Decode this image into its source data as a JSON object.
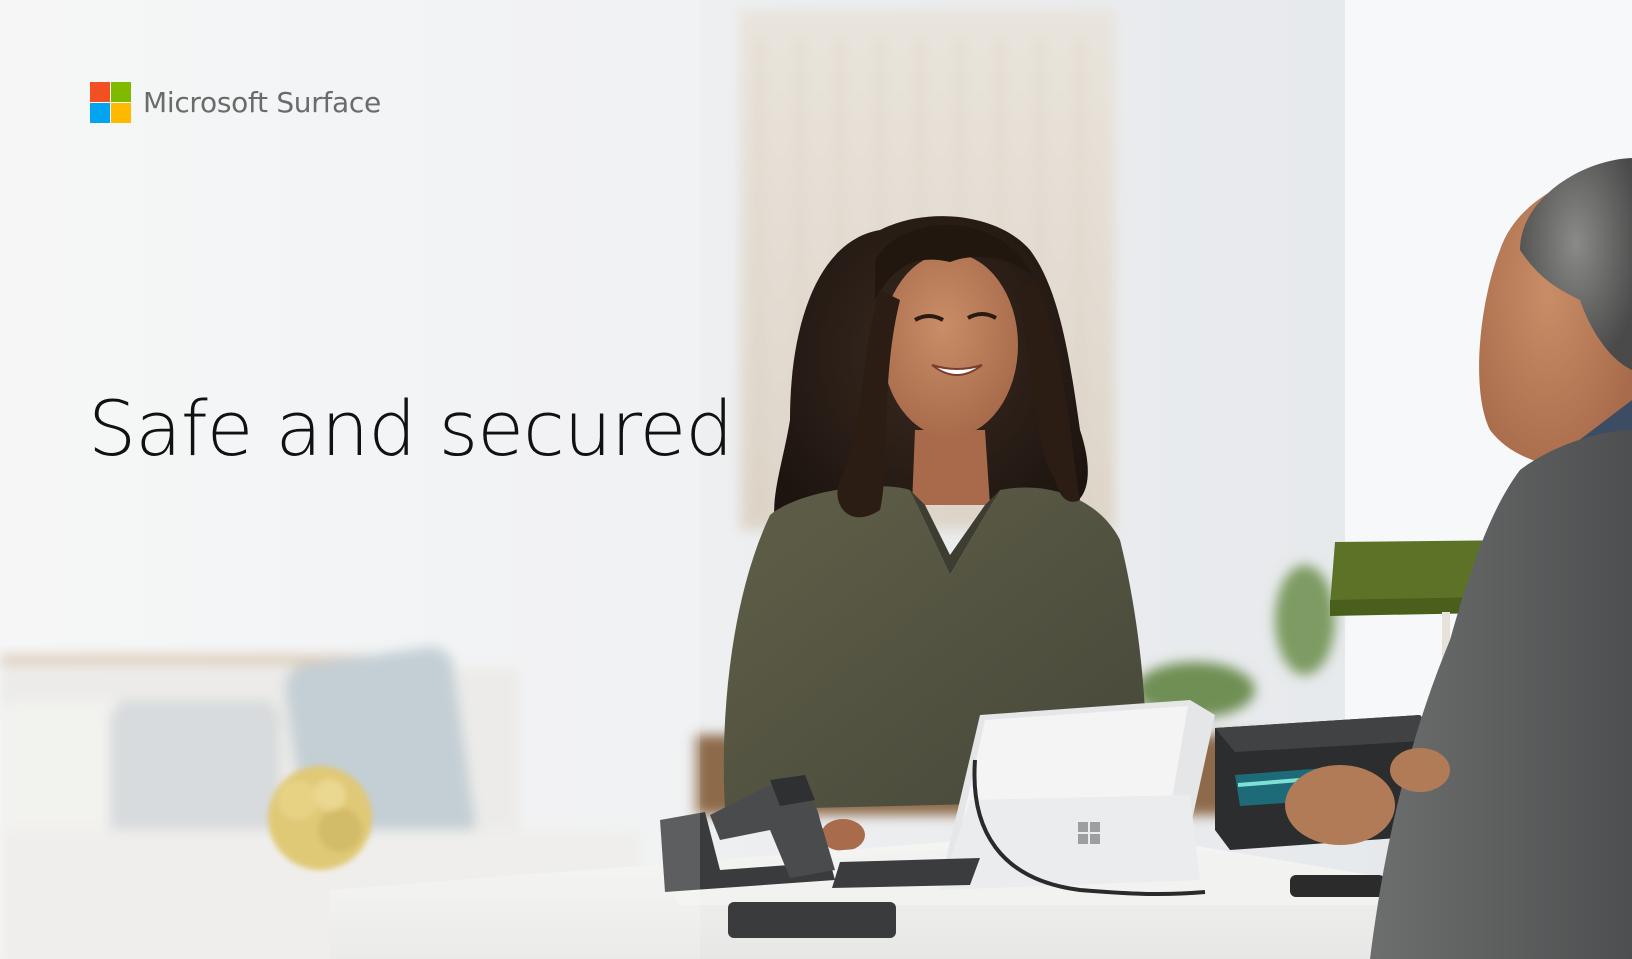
{
  "brand": {
    "name": "Microsoft Surface",
    "logo_colors": [
      "#f25022",
      "#7fba00",
      "#00a4ef",
      "#ffb900"
    ]
  },
  "hero": {
    "headline": "Safe and secured",
    "image": "photo-retail-checkout-scene"
  },
  "colors": {
    "background": "#eef0f2",
    "headline": "#111111",
    "logo_text": "#6b6b6b"
  }
}
